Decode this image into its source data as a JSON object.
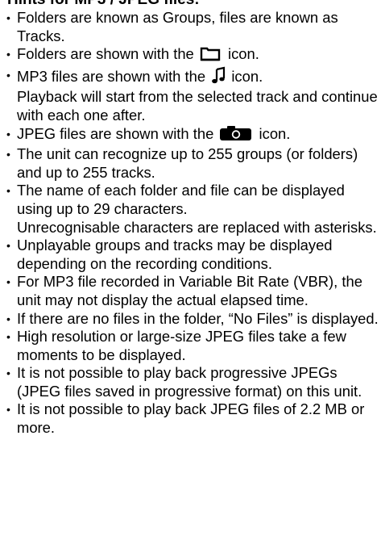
{
  "title": "Hints for MP3 / JPEG files:",
  "bullet": "•",
  "items": [
    {
      "text": "Folders are known as Groups, files are known as Tracks."
    },
    {
      "before": "Folders are shown with the",
      "icon": "folder-icon",
      "after": "icon."
    },
    {
      "before": "MP3 files are shown with the",
      "icon": "music-note-icon",
      "after": "icon.",
      "extra": "Playback will start from the selected track and continue with each one after."
    },
    {
      "before": "JPEG files are shown with the",
      "icon": "camera-icon",
      "after": "icon."
    },
    {
      "text": "The unit can recognize up to 255 groups (or folders) and up to 255 tracks."
    },
    {
      "text": "The name of each folder and file can be displayed using up to 29 characters.",
      "extra": "Unrecognisable characters are replaced with asterisks."
    },
    {
      "text": "Unplayable groups and tracks may be displayed depending on the recording conditions."
    },
    {
      "text": "For MP3 file recorded in Variable Bit Rate (VBR), the unit may not display the actual elapsed time."
    },
    {
      "text": "If there are no files in the folder, “No Files” is displayed."
    },
    {
      "text": "High resolution or large-size JPEG files take a few moments to be displayed."
    },
    {
      "text": "It is not possible to play back progressive JPEGs (JPEG files saved in progressive format) on this unit."
    },
    {
      "text": "It is not possible to play back JPEG files of 2.2 MB or more."
    }
  ]
}
